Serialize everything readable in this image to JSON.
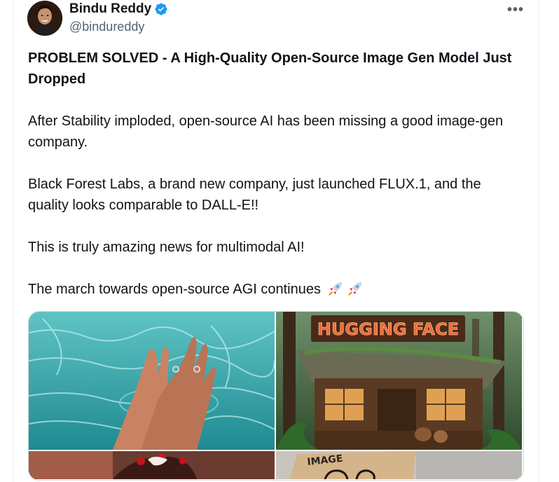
{
  "author": {
    "display_name": "Bindu Reddy",
    "handle": "@bindureddy",
    "verified": true
  },
  "menu": {
    "more_label": "•••"
  },
  "tweet": {
    "headline": "PROBLEM SOLVED - A High-Quality Open-Source Image Gen Model Just Dropped",
    "paragraphs": [
      "After Stability imploded, open-source AI has been missing a good image-gen company.",
      "Black Forest Labs, a brand new company, just launched FLUX.1, and the quality looks comparable to DALL-E!!",
      "This is truly amazing news for multimodal AI!",
      "The march towards open-source AGI continues"
    ],
    "trailing_emoji": [
      "rocket",
      "rocket"
    ]
  },
  "media": {
    "images": [
      {
        "name": "hands-in-water-image"
      },
      {
        "name": "hugging-face-shop-image",
        "sign_text": "HUGGING FACE"
      },
      {
        "name": "cake-image"
      },
      {
        "name": "sign-image",
        "sign_text": "IMAGE"
      }
    ]
  },
  "colors": {
    "text": "#0f1419",
    "secondary": "#536471",
    "verified_blue": "#1d9bf0",
    "border": "#cfd9de"
  }
}
